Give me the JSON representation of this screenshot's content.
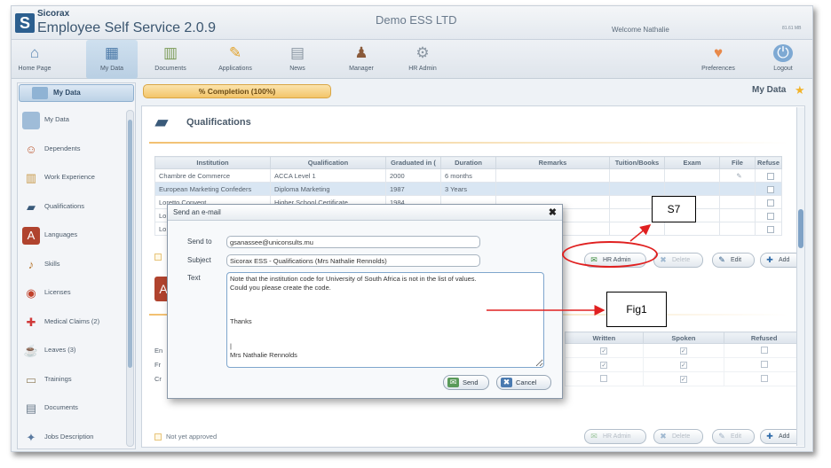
{
  "header": {
    "logo_letter": "S",
    "logo_name": "Sicorax",
    "app_title": "Employee Self Service 2.0.9",
    "company": "Demo ESS LTD",
    "welcome": "Welcome Nathalie",
    "version": "81.61 MB"
  },
  "toolbar": {
    "items": [
      {
        "label": "Home Page",
        "icon": "home-icon"
      },
      {
        "label": "My Data",
        "icon": "mydata-icon"
      },
      {
        "label": "Documents",
        "icon": "documents-icon"
      },
      {
        "label": "Applications",
        "icon": "applications-icon"
      },
      {
        "label": "News",
        "icon": "news-icon"
      },
      {
        "label": "Manager",
        "icon": "manager-icon"
      },
      {
        "label": "HR Admin",
        "icon": "hr-admin-icon"
      },
      {
        "label": "Preferences",
        "icon": "heart-icon"
      },
      {
        "label": "Logout",
        "icon": "power-icon"
      }
    ]
  },
  "sidebar": {
    "title": "My Data",
    "items": [
      {
        "label": "My Data",
        "icon": "mydata-icon"
      },
      {
        "label": "Dependents",
        "icon": "dependents-icon"
      },
      {
        "label": "Work Experience",
        "icon": "work-experience-icon"
      },
      {
        "label": "Qualifications",
        "icon": "qualifications-icon"
      },
      {
        "label": "Languages",
        "icon": "languages-icon"
      },
      {
        "label": "Skills",
        "icon": "skills-icon"
      },
      {
        "label": "Licenses",
        "icon": "licenses-icon"
      },
      {
        "label": "Medical Claims (2)",
        "icon": "medical-icon"
      },
      {
        "label": "Leaves (3)",
        "icon": "leaves-icon"
      },
      {
        "label": "Trainings",
        "icon": "trainings-icon"
      },
      {
        "label": "Documents",
        "icon": "documents-icon"
      },
      {
        "label": "Jobs Description",
        "icon": "jobs-icon"
      }
    ]
  },
  "main": {
    "completion": "% Completion (100%)",
    "breadcrumb": "My Data",
    "section_title": "Qualifications",
    "columns": [
      "Institution",
      "Qualification",
      "Graduated in (",
      "Duration",
      "Remarks",
      "Tuition/Books",
      "Exam",
      "File",
      "Refuse"
    ],
    "rows": [
      [
        "Chambre de Commerce",
        "ACCA Level 1",
        "2000",
        "6 months",
        "",
        "",
        "",
        "",
        ""
      ],
      [
        "European Marketing Confeders",
        "Diploma Marketing",
        "1987",
        "3 Years",
        "",
        "",
        "",
        "",
        ""
      ],
      [
        "Loretto Convent",
        "Higher School Certificate",
        "1984",
        "",
        "",
        "",
        "",
        "",
        ""
      ],
      [
        "Lo",
        "",
        "",
        "",
        "",
        "",
        "",
        "",
        ""
      ],
      [
        "Lo",
        "",
        "",
        "",
        "",
        "",
        "",
        "",
        ""
      ]
    ],
    "buttons": {
      "hr_admin": "HR Admin",
      "delete": "Delete",
      "edit": "Edit",
      "add": "Add"
    },
    "lang_columns": [
      "Written",
      "Spoken",
      "Refused"
    ],
    "lang_rows_prefix": [
      "En",
      "Fr",
      "Cr"
    ],
    "legend": "Not yet approved"
  },
  "dialog": {
    "title": "Send an e-mail",
    "send_to_label": "Send to",
    "send_to": "gsanassee@uniconsults.mu",
    "subject_label": "Subject",
    "subject": "Sicorax ESS - Qualifications (Mrs Nathalie Rennolds)",
    "text_label": "Text",
    "text": "Note that the institution code for University of South Africa is not in the list of values.\nCould you please create the code.\n\n\n\nThanks\n\n\n|\nMrs Nathalie Rennolds",
    "send": "Send",
    "cancel": "Cancel"
  },
  "annotations": {
    "s7": "S7",
    "fig1": "Fig1"
  },
  "colors": {
    "annotation_red": "#e02020",
    "completion_orange": "#f3c56a",
    "selection_blue": "#d9e6f3"
  }
}
